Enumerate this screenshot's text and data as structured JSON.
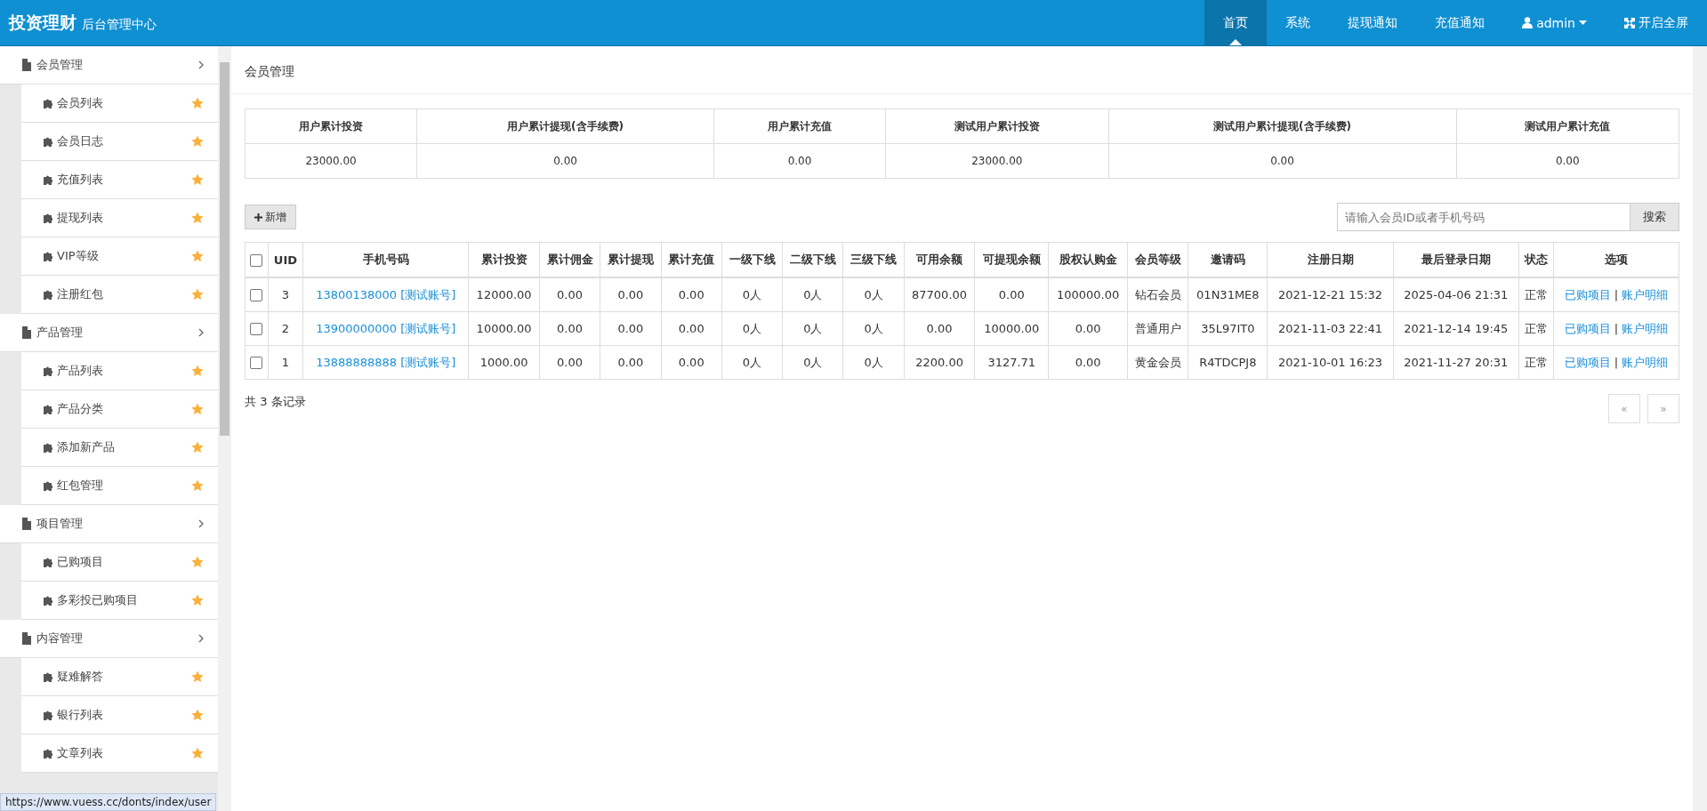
{
  "header": {
    "brand": "投资理财",
    "subtitle": "后台管理中心",
    "nav": [
      {
        "label": "首页",
        "selected": true
      },
      {
        "label": "系统",
        "selected": false
      },
      {
        "label": "提现通知",
        "selected": false
      },
      {
        "label": "充值通知",
        "selected": false
      }
    ],
    "user": "admin",
    "fullscreen": "开启全屏"
  },
  "sidebar": {
    "groups": [
      {
        "label": "会员管理",
        "children": [
          "会员列表",
          "会员日志",
          "充值列表",
          "提现列表",
          "VIP等级",
          "注册红包"
        ]
      },
      {
        "label": "产品管理",
        "children": [
          "产品列表",
          "产品分类",
          "添加新产品",
          "红包管理"
        ]
      },
      {
        "label": "项目管理",
        "children": [
          "已购项目",
          "多彩投已购项目"
        ]
      },
      {
        "label": "内容管理",
        "children": [
          "疑难解答",
          "银行列表",
          "文章列表"
        ]
      }
    ]
  },
  "page_title": "会员管理",
  "summary": {
    "columns": [
      "用户累计投资",
      "用户累计提现(含手续费)",
      "用户累计充值",
      "测试用户累计投资",
      "测试用户累计提现(含手续费)",
      "测试用户累计充值"
    ],
    "values": [
      "23000.00",
      "0.00",
      "0.00",
      "23000.00",
      "0.00",
      "0.00"
    ]
  },
  "add_button": "新增",
  "search": {
    "placeholder": "请输入会员ID或者手机号码",
    "button": "搜索"
  },
  "table": {
    "columns": [
      "UID",
      "手机号码",
      "累计投资",
      "累计佣金",
      "累计提现",
      "累计充值",
      "一级下线",
      "二级下线",
      "三级下线",
      "可用余额",
      "可提现余额",
      "股权认购金",
      "会员等级",
      "邀请码",
      "注册日期",
      "最后登录日期",
      "状态",
      "选项"
    ],
    "select_all_checked": false,
    "rows": [
      {
        "checked": false,
        "uid": "3",
        "phone": "13800138000 [测试账号]",
        "values": [
          "12000.00",
          "0.00",
          "0.00",
          "0.00",
          "0人",
          "0人",
          "0人",
          "87700.00",
          "0.00",
          "100000.00",
          "钻石会员",
          "01N31ME8",
          "2021-12-21 15:32",
          "2025-04-06 21:31",
          "正常"
        ],
        "actions": [
          "已购项目",
          "|",
          "账户明细"
        ]
      },
      {
        "checked": false,
        "uid": "2",
        "phone": "13900000000 [测试账号]",
        "values": [
          "10000.00",
          "0.00",
          "0.00",
          "0.00",
          "0人",
          "0人",
          "0人",
          "0.00",
          "10000.00",
          "0.00",
          "普通用户",
          "35L97IT0",
          "2021-11-03 22:41",
          "2021-12-14 19:45",
          "正常"
        ],
        "actions": [
          "已购项目",
          "|",
          "账户明细"
        ]
      },
      {
        "checked": false,
        "uid": "1",
        "phone": "13888888888 [测试账号]",
        "values": [
          "1000.00",
          "0.00",
          "0.00",
          "0.00",
          "0人",
          "0人",
          "0人",
          "2200.00",
          "3127.71",
          "0.00",
          "黄金会员",
          "R4TDCPJ8",
          "2021-10-01 16:23",
          "2021-11-27 20:31",
          "正常"
        ],
        "actions": [
          "已购项目",
          "|",
          "账户明细"
        ]
      }
    ]
  },
  "record_count": "共 3 条记录",
  "pagination": [
    "«",
    "»"
  ],
  "status_url": "https://www.vuess.cc/donts/index/user"
}
